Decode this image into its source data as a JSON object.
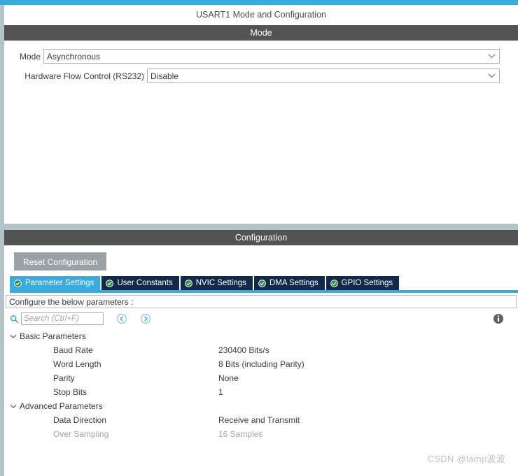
{
  "theme": {
    "accent_blue": "#3aabdc",
    "header_dark": "#515453",
    "tab_inactive": "#13294a",
    "rail_gray": "#b4c2c9",
    "reset_gray": "#9aa2a6",
    "check_green": "#2e8b4a"
  },
  "header": {
    "title": "USART1 Mode and Configuration"
  },
  "mode_section": {
    "band_title": "Mode",
    "rows": [
      {
        "label": "Mode",
        "value": "Asynchronous",
        "caret": "chevron-down-icon"
      },
      {
        "label": "Hardware Flow Control (RS232)",
        "value": "Disable",
        "caret": "chevron-down-icon"
      }
    ]
  },
  "configuration_section": {
    "band_title": "Configuration",
    "reset_label": "Reset Configuration",
    "tabs": [
      {
        "label": "Parameter Settings",
        "active": true,
        "icon": "check-circle-icon"
      },
      {
        "label": "User Constants",
        "active": false,
        "icon": "check-circle-icon"
      },
      {
        "label": "NVIC Settings",
        "active": false,
        "icon": "check-circle-icon"
      },
      {
        "label": "DMA Settings",
        "active": false,
        "icon": "check-circle-icon"
      },
      {
        "label": "GPIO Settings",
        "active": false,
        "icon": "check-circle-icon"
      }
    ],
    "description": "Configure the below parameters :",
    "search": {
      "placeholder": "Search (Ctrl+F)",
      "value": "",
      "icon": "search-icon",
      "prev_icon": "nav-previous-icon",
      "next_icon": "nav-next-icon"
    },
    "info_icon": "info-icon",
    "groups": [
      {
        "label": "Basic Parameters",
        "expanded": true,
        "chevron": "chevron-down-icon",
        "params": [
          {
            "name": "Baud Rate",
            "value": "230400 Bits/s",
            "disabled": false
          },
          {
            "name": "Word Length",
            "value": "8 Bits (including Parity)",
            "disabled": false
          },
          {
            "name": "Parity",
            "value": "None",
            "disabled": false
          },
          {
            "name": "Stop Bits",
            "value": "1",
            "disabled": false
          }
        ]
      },
      {
        "label": "Advanced Parameters",
        "expanded": true,
        "chevron": "chevron-down-icon",
        "params": [
          {
            "name": "Data Direction",
            "value": "Receive and Transmit",
            "disabled": false
          },
          {
            "name": "Over Sampling",
            "value": "16 Samples",
            "disabled": true
          }
        ]
      }
    ]
  },
  "watermark": {
    "text": "CSDN @lamp波波"
  }
}
